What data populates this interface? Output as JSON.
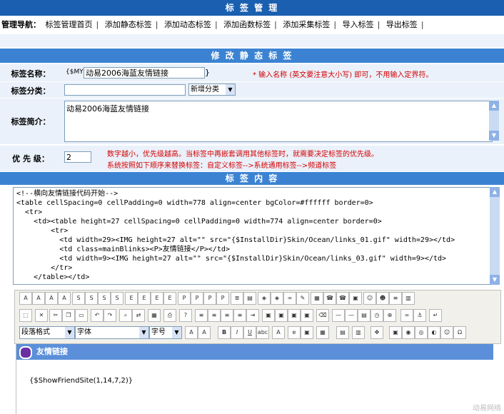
{
  "title": "标 签 管 理",
  "nav": {
    "label": "管理导航：",
    "items": [
      "标签管理首页",
      "添加静态标签",
      "添加动态标签",
      "添加函数标签",
      "添加采集标签",
      "导入标签",
      "导出标签"
    ],
    "separator": "|"
  },
  "edit_section_title": "修 改 静 态 标 签",
  "form": {
    "name_label": "标签名称：",
    "name_prefix": "{$MY",
    "name_value": "动易2006海蓝友情链接",
    "name_suffix": "}",
    "name_hint": "* 输入名称 (英文要注意大小写) 即可，不用输入定界符。",
    "category_label": "标签分类：",
    "category_value": "",
    "category_select": "新增分类",
    "intro_label": "标签简介：",
    "intro_value": "动易2006海蓝友情链接",
    "priority_label": "优 先 级：",
    "priority_value": "2",
    "priority_hint_1": "数字越小，优先级越高。当标签中再嵌套调用其他标签时，就需要决定标签的优先级。",
    "priority_hint_2": "系统按照如下顺序来替换标签：自定义标签-->系统通用标签-->频道标签"
  },
  "content_section_title": "标 签 内 容",
  "code": "<!--横向友情链接代码开始-->\n<table cellSpacing=0 cellPadding=0 width=778 align=center bgColor=#ffffff border=0>\n  <tr>\n    <td><table height=27 cellSpacing=0 cellPadding=0 width=774 align=center border=0>\n        <tr>\n          <td width=29><IMG height=27 alt=\"\" src=\"{$InstallDir}Skin/Ocean/links_01.gif\" width=29></td>\n          <td class=mainBlinks><P>友情链接</P></td>\n          <td width=9><IMG height=27 alt=\"\" src=\"{$InstallDir}Skin/Ocean/links_03.gif\" width=9></td>\n        </tr>\n    </table></td>",
  "editor": {
    "paragraph_select": "段落格式",
    "font_select": "字体",
    "size_select": "字号",
    "friend_title": "友情链接",
    "friend_call": "{$ShowFriendSite(1,14,7,2)}"
  },
  "watermark": "动易网络",
  "colors": {
    "header": "#1a5fb0",
    "subheader": "#3b83d2",
    "hint": "#d40000",
    "row_bg": "#eaf1fa"
  }
}
